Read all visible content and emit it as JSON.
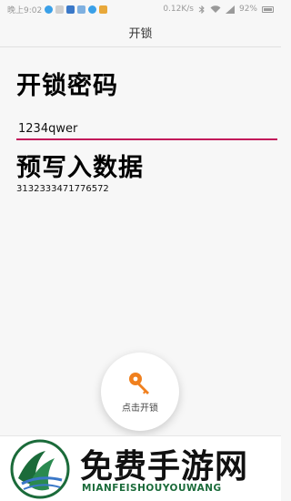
{
  "status_bar": {
    "time": "晚上9:02",
    "network_speed": "0.12K/s",
    "battery": "92%"
  },
  "toolbar": {
    "title": "开锁"
  },
  "password_section": {
    "title": "开锁密码",
    "value": "1234qwer"
  },
  "prewrite_section": {
    "title": "预写入数据",
    "value": "3132333471776572"
  },
  "unlock_button": {
    "label": "点击开锁",
    "icon": "key-icon"
  },
  "watermark": {
    "title": "免费手游网",
    "subtitle": "MIANFEISHOUYOUWANG"
  },
  "colors": {
    "accent": "#c2185b",
    "key": "#f0801e",
    "brand_green": "#1b6b3a"
  }
}
